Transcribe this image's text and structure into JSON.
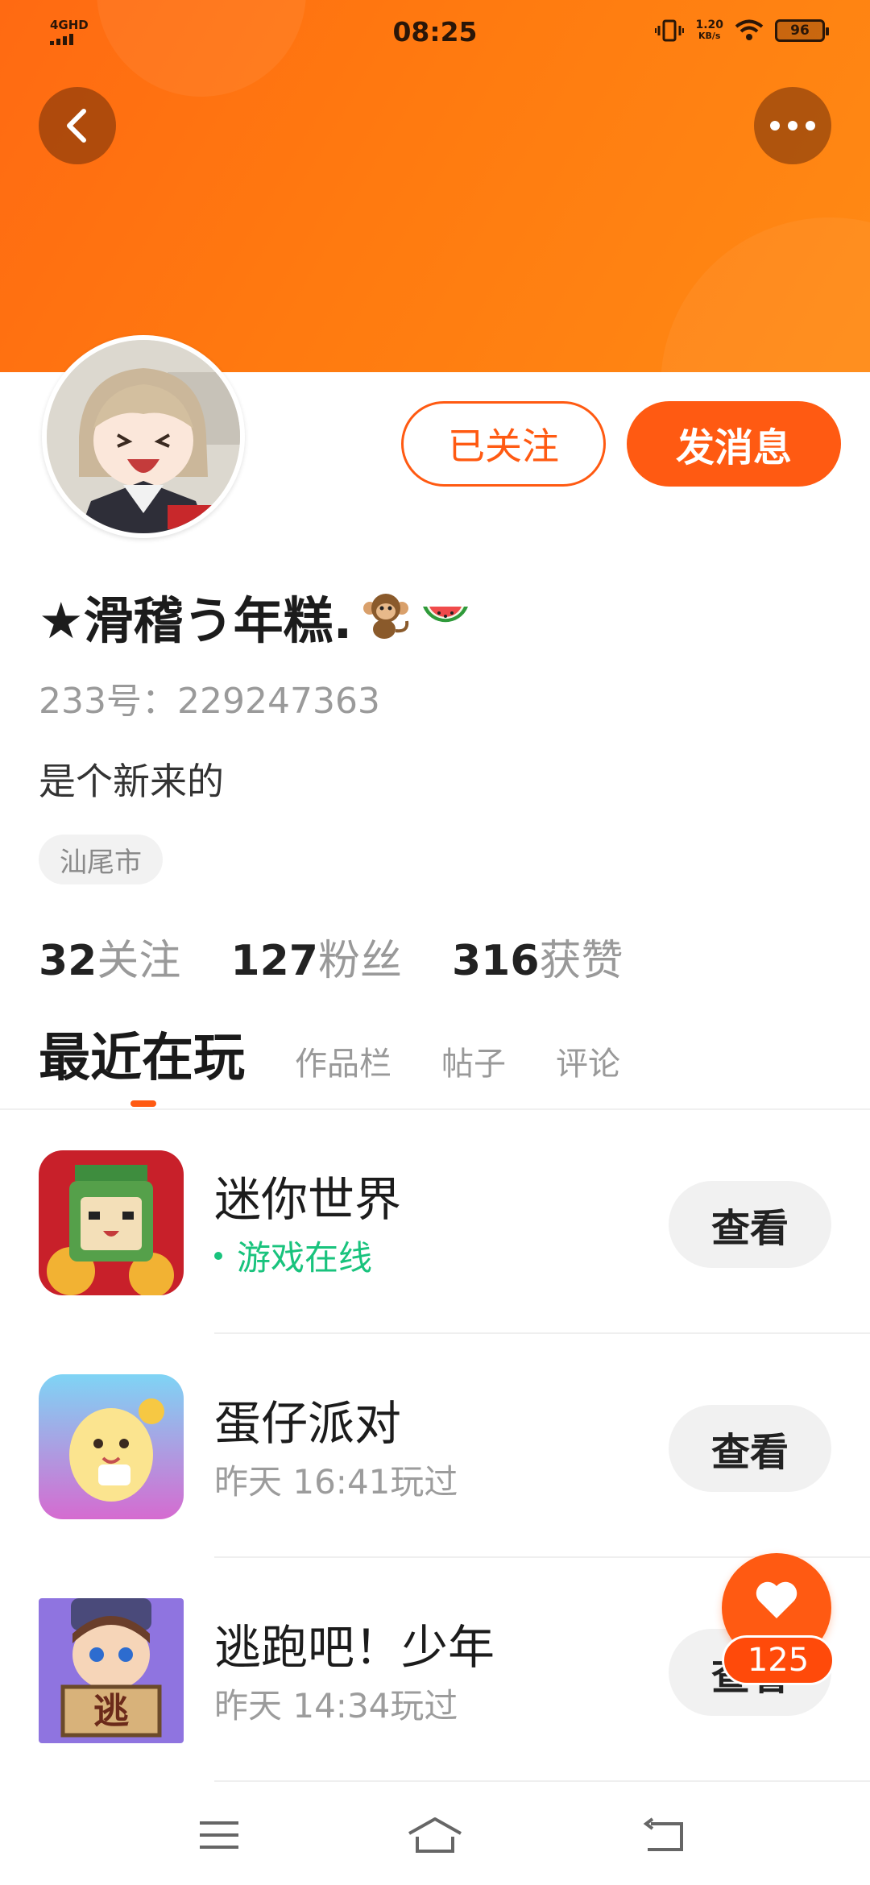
{
  "status_bar": {
    "network": "4GHD",
    "time": "08:25",
    "speed_value": "1.20",
    "speed_unit": "KB/s",
    "battery": "96"
  },
  "profile": {
    "name": "★滑稽う年糕.",
    "name_emojis": [
      "monkey",
      "watermelon"
    ],
    "uid": "233号：229247363",
    "bio": "是个新来的",
    "location": "汕尾市",
    "follow_label": "已关注",
    "message_label": "发消息"
  },
  "stats": [
    {
      "value": "32",
      "label": "关注"
    },
    {
      "value": "127",
      "label": "粉丝"
    },
    {
      "value": "316",
      "label": "获赞"
    }
  ],
  "tabs": [
    {
      "label": "最近在玩",
      "active": true
    },
    {
      "label": "作品栏",
      "active": false
    },
    {
      "label": "帖子",
      "active": false
    },
    {
      "label": "评论",
      "active": false
    }
  ],
  "games": [
    {
      "title": "迷你世界",
      "subtitle": "游戏在线",
      "online": true,
      "action": "查看"
    },
    {
      "title": "蛋仔派对",
      "subtitle": "昨天 16:41玩过",
      "online": false,
      "action": "查看"
    },
    {
      "title": "逃跑吧！少年",
      "subtitle": "昨天 14:34玩过",
      "online": false,
      "action": "查看"
    }
  ],
  "like": {
    "count": "125"
  },
  "icons": {
    "back": "back-arrow-icon",
    "more": "more-dots-icon",
    "like": "heart-icon",
    "nav_menu": "menu-icon",
    "nav_home": "home-icon",
    "nav_back": "return-icon"
  },
  "colors": {
    "accent": "#ff5a12",
    "online": "#19c37d",
    "header": "#ff7a10"
  }
}
